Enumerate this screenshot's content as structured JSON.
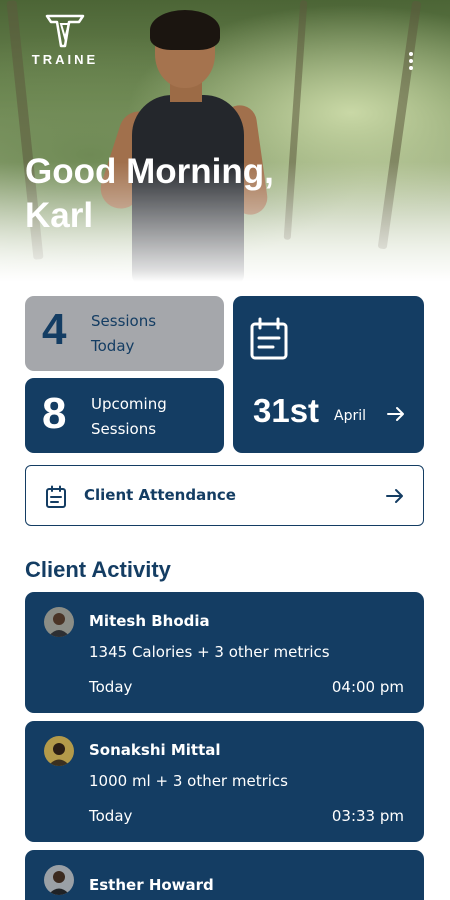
{
  "brand": {
    "name": "TRAINE"
  },
  "header": {
    "greeting": "Good Morning,",
    "user_name": "Karl"
  },
  "stats": {
    "sessions_today": {
      "value": "4",
      "label_line1": "Sessions",
      "label_line2": "Today"
    },
    "upcoming_sessions": {
      "value": "8",
      "label_line1": "Upcoming",
      "label_line2": "Sessions"
    },
    "date": {
      "day": "31st",
      "month": "April"
    }
  },
  "attendance": {
    "label": "Client Attendance"
  },
  "activity": {
    "title": "Client Activity",
    "items": [
      {
        "name": "Mitesh Bhodia",
        "metric": "1345 Calories + 3 other  metrics",
        "day": "Today",
        "time": "04:00 pm"
      },
      {
        "name": "Sonakshi Mittal",
        "metric": "1000 ml + 3 other  metrics",
        "day": "Today",
        "time": "03:33 pm"
      },
      {
        "name": "Esther Howard",
        "metric": "",
        "day": "",
        "time": ""
      }
    ]
  },
  "colors": {
    "navy": "#143d63",
    "grey_card": "#a5a7ab",
    "white": "#ffffff"
  },
  "icons": [
    "traine-logo-icon",
    "more-vertical-icon",
    "calendar-icon",
    "arrow-right-icon",
    "document-icon"
  ]
}
